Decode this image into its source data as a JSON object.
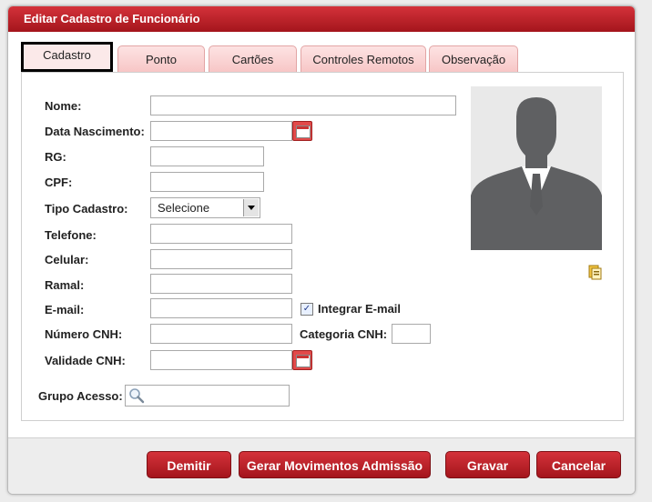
{
  "dialog": {
    "title": "Editar Cadastro de Funcionário"
  },
  "tabs": [
    {
      "label": "Cadastro"
    },
    {
      "label": "Ponto"
    },
    {
      "label": "Cartões"
    },
    {
      "label": "Controles Remotos"
    },
    {
      "label": "Observação"
    }
  ],
  "form": {
    "nome": {
      "label": "Nome:",
      "value": ""
    },
    "data_nascimento": {
      "label": "Data Nascimento:",
      "value": ""
    },
    "rg": {
      "label": "RG:",
      "value": ""
    },
    "cpf": {
      "label": "CPF:",
      "value": ""
    },
    "tipo_cadastro": {
      "label": "Tipo Cadastro:",
      "value": "Selecione"
    },
    "telefone": {
      "label": "Telefone:",
      "value": ""
    },
    "celular": {
      "label": "Celular:",
      "value": ""
    },
    "ramal": {
      "label": "Ramal:",
      "value": ""
    },
    "email": {
      "label": "E-mail:",
      "value": ""
    },
    "integrar_email": {
      "label": "Integrar E-mail",
      "checked": true
    },
    "numero_cnh": {
      "label": "Número CNH:",
      "value": ""
    },
    "categoria_cnh": {
      "label": "Categoria CNH:",
      "value": ""
    },
    "validade_cnh": {
      "label": "Validade CNH:",
      "value": ""
    },
    "grupo_acesso": {
      "label": "Grupo Acesso:",
      "value": ""
    }
  },
  "footer": {
    "demitir": "Demitir",
    "gerar": "Gerar Movimentos Admissão",
    "gravar": "Gravar",
    "cancelar": "Cancelar"
  },
  "icons": {
    "calendar": "calendar-icon",
    "search": "search-icon",
    "photo_upload": "photo-upload-icon",
    "dropdown": "chevron-down-icon"
  },
  "colors": {
    "accent": "#b61d25",
    "tab_bg": "#f7c6c6"
  }
}
